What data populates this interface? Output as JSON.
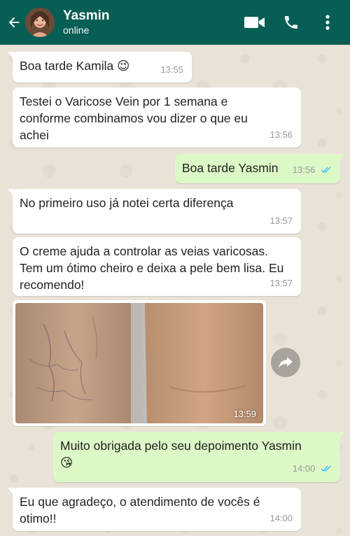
{
  "header": {
    "contact_name": "Yasmin",
    "status": "online"
  },
  "messages": [
    {
      "text": "Boa tarde Kamila 😉",
      "time": "13:55"
    },
    {
      "text": "Testei o Varicose Vein por 1 semana e conforme combinamos vou dizer o que eu achei",
      "time": "13:56"
    },
    {
      "text": "Boa tarde Yasmin",
      "time": "13:56"
    },
    {
      "text": "No primeiro uso já notei certa diferença",
      "time": "13:57"
    },
    {
      "text": "O creme ajuda a controlar as veias varicosas. Tem um ótimo cheiro e deixa a pele bem lisa. Eu recomendo!",
      "time": "13:57"
    },
    {
      "time": "13:59"
    },
    {
      "text": "Muito obrigada pelo seu depoimento Yasmin",
      "emoji": "😘",
      "time": "14:00"
    },
    {
      "text": "Eu que agradeço, o atendimento de vocês é otimo!!",
      "time": "14:00"
    }
  ],
  "colors": {
    "header_bg": "#075e54",
    "incoming_bubble": "#ffffff",
    "outgoing_bubble": "#dcf8c6",
    "read_ticks": "#4fc3f7"
  },
  "icons": [
    "back-arrow-icon",
    "video-call-icon",
    "phone-icon",
    "more-options-icon",
    "forward-icon",
    "double-check-icon"
  ]
}
